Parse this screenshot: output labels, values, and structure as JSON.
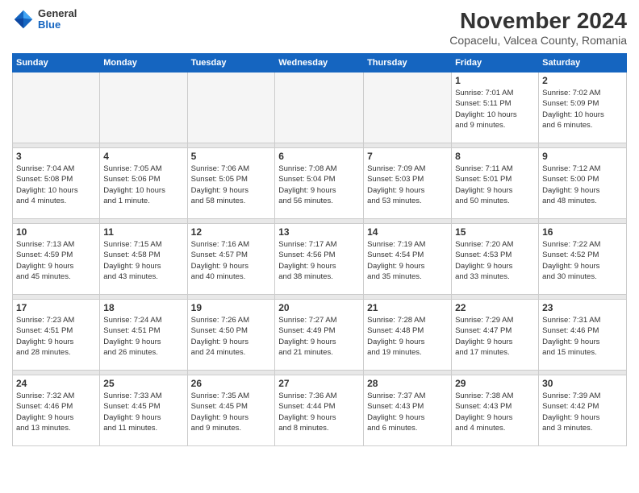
{
  "logo": {
    "general": "General",
    "blue": "Blue"
  },
  "title": "November 2024",
  "location": "Copacelu, Valcea County, Romania",
  "days_header": [
    "Sunday",
    "Monday",
    "Tuesday",
    "Wednesday",
    "Thursday",
    "Friday",
    "Saturday"
  ],
  "weeks": [
    {
      "days": [
        {
          "num": "",
          "info": ""
        },
        {
          "num": "",
          "info": ""
        },
        {
          "num": "",
          "info": ""
        },
        {
          "num": "",
          "info": ""
        },
        {
          "num": "",
          "info": ""
        },
        {
          "num": "1",
          "info": "Sunrise: 7:01 AM\nSunset: 5:11 PM\nDaylight: 10 hours\nand 9 minutes."
        },
        {
          "num": "2",
          "info": "Sunrise: 7:02 AM\nSunset: 5:09 PM\nDaylight: 10 hours\nand 6 minutes."
        }
      ]
    },
    {
      "days": [
        {
          "num": "3",
          "info": "Sunrise: 7:04 AM\nSunset: 5:08 PM\nDaylight: 10 hours\nand 4 minutes."
        },
        {
          "num": "4",
          "info": "Sunrise: 7:05 AM\nSunset: 5:06 PM\nDaylight: 10 hours\nand 1 minute."
        },
        {
          "num": "5",
          "info": "Sunrise: 7:06 AM\nSunset: 5:05 PM\nDaylight: 9 hours\nand 58 minutes."
        },
        {
          "num": "6",
          "info": "Sunrise: 7:08 AM\nSunset: 5:04 PM\nDaylight: 9 hours\nand 56 minutes."
        },
        {
          "num": "7",
          "info": "Sunrise: 7:09 AM\nSunset: 5:03 PM\nDaylight: 9 hours\nand 53 minutes."
        },
        {
          "num": "8",
          "info": "Sunrise: 7:11 AM\nSunset: 5:01 PM\nDaylight: 9 hours\nand 50 minutes."
        },
        {
          "num": "9",
          "info": "Sunrise: 7:12 AM\nSunset: 5:00 PM\nDaylight: 9 hours\nand 48 minutes."
        }
      ]
    },
    {
      "days": [
        {
          "num": "10",
          "info": "Sunrise: 7:13 AM\nSunset: 4:59 PM\nDaylight: 9 hours\nand 45 minutes."
        },
        {
          "num": "11",
          "info": "Sunrise: 7:15 AM\nSunset: 4:58 PM\nDaylight: 9 hours\nand 43 minutes."
        },
        {
          "num": "12",
          "info": "Sunrise: 7:16 AM\nSunset: 4:57 PM\nDaylight: 9 hours\nand 40 minutes."
        },
        {
          "num": "13",
          "info": "Sunrise: 7:17 AM\nSunset: 4:56 PM\nDaylight: 9 hours\nand 38 minutes."
        },
        {
          "num": "14",
          "info": "Sunrise: 7:19 AM\nSunset: 4:54 PM\nDaylight: 9 hours\nand 35 minutes."
        },
        {
          "num": "15",
          "info": "Sunrise: 7:20 AM\nSunset: 4:53 PM\nDaylight: 9 hours\nand 33 minutes."
        },
        {
          "num": "16",
          "info": "Sunrise: 7:22 AM\nSunset: 4:52 PM\nDaylight: 9 hours\nand 30 minutes."
        }
      ]
    },
    {
      "days": [
        {
          "num": "17",
          "info": "Sunrise: 7:23 AM\nSunset: 4:51 PM\nDaylight: 9 hours\nand 28 minutes."
        },
        {
          "num": "18",
          "info": "Sunrise: 7:24 AM\nSunset: 4:51 PM\nDaylight: 9 hours\nand 26 minutes."
        },
        {
          "num": "19",
          "info": "Sunrise: 7:26 AM\nSunset: 4:50 PM\nDaylight: 9 hours\nand 24 minutes."
        },
        {
          "num": "20",
          "info": "Sunrise: 7:27 AM\nSunset: 4:49 PM\nDaylight: 9 hours\nand 21 minutes."
        },
        {
          "num": "21",
          "info": "Sunrise: 7:28 AM\nSunset: 4:48 PM\nDaylight: 9 hours\nand 19 minutes."
        },
        {
          "num": "22",
          "info": "Sunrise: 7:29 AM\nSunset: 4:47 PM\nDaylight: 9 hours\nand 17 minutes."
        },
        {
          "num": "23",
          "info": "Sunrise: 7:31 AM\nSunset: 4:46 PM\nDaylight: 9 hours\nand 15 minutes."
        }
      ]
    },
    {
      "days": [
        {
          "num": "24",
          "info": "Sunrise: 7:32 AM\nSunset: 4:46 PM\nDaylight: 9 hours\nand 13 minutes."
        },
        {
          "num": "25",
          "info": "Sunrise: 7:33 AM\nSunset: 4:45 PM\nDaylight: 9 hours\nand 11 minutes."
        },
        {
          "num": "26",
          "info": "Sunrise: 7:35 AM\nSunset: 4:45 PM\nDaylight: 9 hours\nand 9 minutes."
        },
        {
          "num": "27",
          "info": "Sunrise: 7:36 AM\nSunset: 4:44 PM\nDaylight: 9 hours\nand 8 minutes."
        },
        {
          "num": "28",
          "info": "Sunrise: 7:37 AM\nSunset: 4:43 PM\nDaylight: 9 hours\nand 6 minutes."
        },
        {
          "num": "29",
          "info": "Sunrise: 7:38 AM\nSunset: 4:43 PM\nDaylight: 9 hours\nand 4 minutes."
        },
        {
          "num": "30",
          "info": "Sunrise: 7:39 AM\nSunset: 4:42 PM\nDaylight: 9 hours\nand 3 minutes."
        }
      ]
    }
  ]
}
